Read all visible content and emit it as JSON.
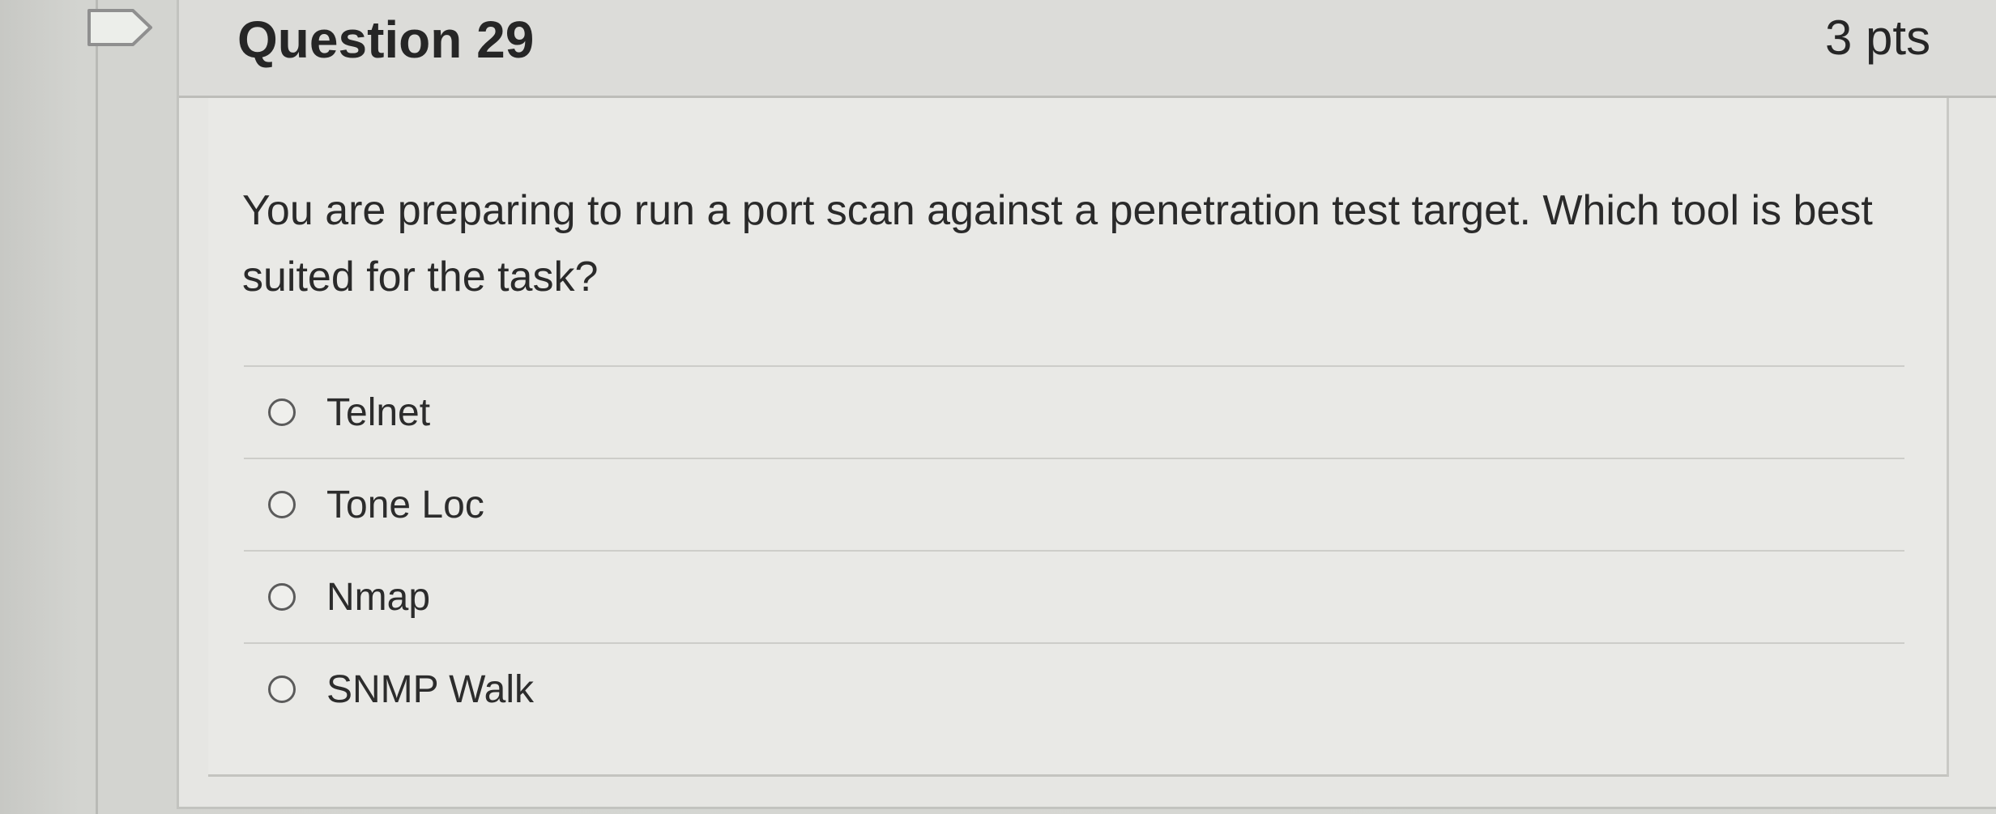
{
  "question": {
    "title": "Question 29",
    "points": "3 pts",
    "text": "You are preparing to run a port scan against a penetration test target. Which tool is best suited for the task?",
    "answers": [
      {
        "label": "Telnet",
        "selected": false
      },
      {
        "label": "Tone Loc",
        "selected": false
      },
      {
        "label": "Nmap",
        "selected": false
      },
      {
        "label": "SNMP Walk",
        "selected": false
      }
    ]
  },
  "icons": {
    "flag": "flag-question-icon"
  },
  "colors": {
    "text": "#262626",
    "card_background": "#e6e6e3",
    "border": "#c2c3bf"
  }
}
